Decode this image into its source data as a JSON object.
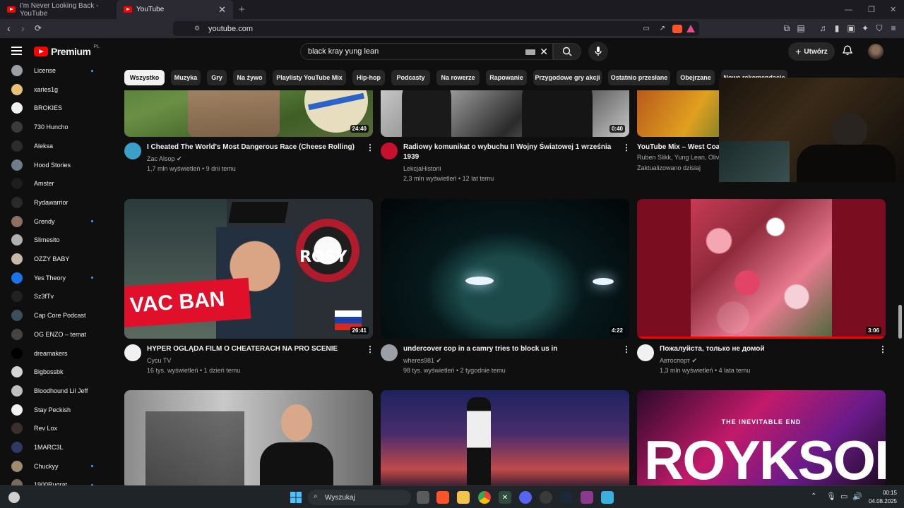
{
  "browser": {
    "tabs": [
      {
        "label": "I'm Never Looking Back - YouTube",
        "active": false
      },
      {
        "label": "YouTube",
        "active": true
      }
    ],
    "url": "youtube.com"
  },
  "youtube": {
    "logo": "Premium",
    "logo_region": "PL",
    "search_value": "black kray yung lean",
    "create_label": "Utwórz"
  },
  "sidebar": {
    "items": [
      {
        "label": "License",
        "dot": true,
        "color": "#9aa0a6"
      },
      {
        "label": "xaries1g",
        "dot": false,
        "color": "#e8c07a"
      },
      {
        "label": "BROKIES",
        "dot": false,
        "color": "#f1f1f1"
      },
      {
        "label": "730 Huncho",
        "dot": false,
        "color": "#3a3a3a"
      },
      {
        "label": "Aleksa",
        "dot": false,
        "color": "#2c2c2c"
      },
      {
        "label": "Hood Stories",
        "dot": false,
        "color": "#6d7d8a"
      },
      {
        "label": "Amster",
        "dot": false,
        "color": "#1e1e1e"
      },
      {
        "label": "Rydawarrior",
        "dot": false,
        "color": "#2a2a2a"
      },
      {
        "label": "Grendy",
        "dot": true,
        "color": "#8c7160"
      },
      {
        "label": "Slimesito",
        "dot": false,
        "color": "#b0b0b0"
      },
      {
        "label": "OZZY BABY",
        "dot": false,
        "color": "#c7b8a8"
      },
      {
        "label": "Yes Theory",
        "dot": true,
        "color": "#1a73e8"
      },
      {
        "label": "Sz3fTv",
        "dot": false,
        "color": "#222222"
      },
      {
        "label": "Cap Core Podcast",
        "dot": false,
        "color": "#3b4f5c"
      },
      {
        "label": "OG ENZO – temat",
        "dot": false,
        "color": "#444444"
      },
      {
        "label": "dreamakers",
        "dot": false,
        "color": "#000000"
      },
      {
        "label": "Bigbossbk",
        "dot": false,
        "color": "#d5d5d5"
      },
      {
        "label": "Bloodhound Lil Jeff",
        "dot": false,
        "color": "#bfbfbf"
      },
      {
        "label": "Stay Peckish",
        "dot": false,
        "color": "#f1f1f1"
      },
      {
        "label": "Rev Lox",
        "dot": false,
        "color": "#3c2f2f"
      },
      {
        "label": "1MARC3L",
        "dot": false,
        "color": "#2d3a66"
      },
      {
        "label": "Chuckyy",
        "dot": true,
        "color": "#a08a70"
      },
      {
        "label": "1900Rugrat",
        "dot": true,
        "color": "#7a6a5a"
      }
    ]
  },
  "chips": [
    "Wszystko",
    "Muzyka",
    "Gry",
    "Na żywo",
    "Playlisty YouTube Mix",
    "Hip-hop",
    "Podcasty",
    "Na rowerze",
    "Rapowanie",
    "Przygodowe gry akcji",
    "Ostatnio przesłane",
    "Obejrzane",
    "Nowe rekomendacje"
  ],
  "videos": [
    {
      "title": "I Cheated The World's Most Dangerous Race (Cheese Rolling)",
      "channel": "Zac Alsop",
      "verified": true,
      "stats": "1,7 mln wyświetleń • 9 dni temu",
      "duration": "24:40"
    },
    {
      "title": "Radiowy komunikat o wybuchu II Wojny Światowej 1 września 1939",
      "channel": "LekcjaHistorii",
      "verified": false,
      "stats": "2,3 mln wyświetleń • 12 lat temu",
      "duration": "0:40"
    },
    {
      "title": "YouTube Mix – West Coa",
      "channel": "Ruben Slikk, Yung Lean, Oliv",
      "verified": false,
      "stats": "Zaktualizowano dzisiaj",
      "duration": ""
    },
    {
      "title": "HYPER OGLĄDA FILM O CHEATERACH NA PRO SCENIE",
      "channel": "Cycu TV",
      "verified": false,
      "stats": "16 tys. wyświetleń • 1 dzień temu",
      "duration": "26:41",
      "overlay_text": "VAC BAN",
      "overlay_text2": "ROSY"
    },
    {
      "title": "undercover cop in a camry tries to block us in",
      "channel": "wheres981",
      "verified": true,
      "stats": "98 tys. wyświetleń • 2 tygodnie temu",
      "duration": "4:22"
    },
    {
      "title": "Пожалуйста, только не домой",
      "channel": "Автоспорт",
      "verified": true,
      "stats": "1,3 mln wyświetleń • 4 lata temu",
      "duration": "3:06"
    },
    {
      "title": "",
      "channel": "",
      "verified": false,
      "stats": "",
      "duration": ""
    },
    {
      "title": "",
      "channel": "",
      "verified": false,
      "stats": "",
      "duration": ""
    },
    {
      "title": "",
      "channel": "",
      "verified": false,
      "stats": "",
      "duration": "",
      "overlay_text": "THE INEVITABLE END",
      "overlay_text2": "ROYKSOPP"
    }
  ],
  "taskbar": {
    "search_label": "Wyszukaj",
    "time": "00:15",
    "date": "04.08.2025"
  },
  "colors": {
    "accent": "#ff0000",
    "link": "#3ea6ff",
    "bg": "#0f0f0f"
  }
}
